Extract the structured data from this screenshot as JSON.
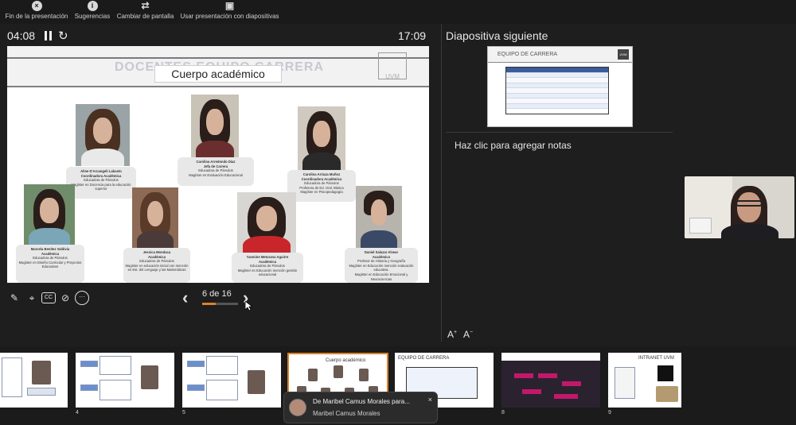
{
  "toolbar": {
    "end_label": "Fin de la presentación",
    "tips_label": "Sugerencias",
    "switch_label": "Cambiar de pantalla",
    "slideshow_label": "Usar presentación con diapositivas"
  },
  "presenter": {
    "elapsed": "04:08",
    "clock": "17:09",
    "next_slide_label": "Diapositiva siguiente",
    "notes_placeholder": "Haz clic para agregar notas",
    "counter": "6 de 16",
    "progress": 0.375,
    "font_increase": "A",
    "font_decrease": "A",
    "cc_label": "CC"
  },
  "slide": {
    "title": "Cuerpo académico",
    "ghost_title": "DOCENTES EQUIPO CARRERA",
    "logo": "UVM",
    "people": [
      {
        "name": "Aline D'Arcangeli Labasto",
        "role": "Coordinadora Académica",
        "lines": [
          "Educadora de Párvulos",
          "Magíster en Docencia para la educación superior"
        ]
      },
      {
        "name": "Carolina Arredondo Díaz",
        "role": "Jefa de Carrera",
        "lines": [
          "Educadora de Párvulos",
          "Magíster en Evaluación Educacional"
        ]
      },
      {
        "name": "Carolina Arriaza Muñoz",
        "role": "Coordinadora Académica",
        "lines": [
          "Educadora de Párvulos",
          "Profesora de Ed. Gral. Básica",
          "Magíster en Psicopedagogía"
        ]
      },
      {
        "name": "Marcela Benítez Valdivia",
        "role": "Académica",
        "lines": [
          "Educadora de Párvulos",
          "Magíster en Diseño Curricular y Proyectos Educativos"
        ]
      },
      {
        "name": "Jessica Mondaca",
        "role": "Académica",
        "lines": [
          "Educadora de Párvulos",
          "Magíster en educación inicial con mención en Est. del Lenguaje y las Matemáticas"
        ]
      },
      {
        "name": "Yasmine Meturana Aguirre",
        "role": "Académica",
        "lines": [
          "Educadora de Párvulos",
          "Magíster en Educación mención gestión educacional"
        ]
      },
      {
        "name": "Daniel Salazar Alvear",
        "role": "Académico",
        "lines": [
          "Profesor de Historia y Geografía",
          "Magíster en Educación mención evaluación educativa.",
          "Magíster en Educación Emocional y Neurociencias"
        ]
      }
    ]
  },
  "next_slide": {
    "title": "EQUIPO DE CARRERA",
    "logo": "UVM"
  },
  "filmstrip": {
    "numbers": [
      "4",
      "5",
      "8",
      "9"
    ],
    "thumb6_title": "Cuerpo académico",
    "thumb7_title": "EQUIPO DE CARRERA",
    "thumb9_title": "INTRANET UVM"
  },
  "toast": {
    "line1": "De Maribel Camus Morales para...",
    "line2": "Maribel Camus Morales",
    "close": "×"
  },
  "colors": {
    "background": "#1e1e1e",
    "accent": "#d9822b",
    "slide_bg": "#ffffff"
  },
  "icons": [
    "close-circle-icon",
    "info-icon",
    "switch-icon",
    "slides-icon",
    "pause-icon",
    "reset-icon",
    "pen-icon",
    "pointer-icon",
    "cc-icon",
    "camera-off-icon",
    "more-icon",
    "chevron-left-icon",
    "chevron-right-icon"
  ]
}
